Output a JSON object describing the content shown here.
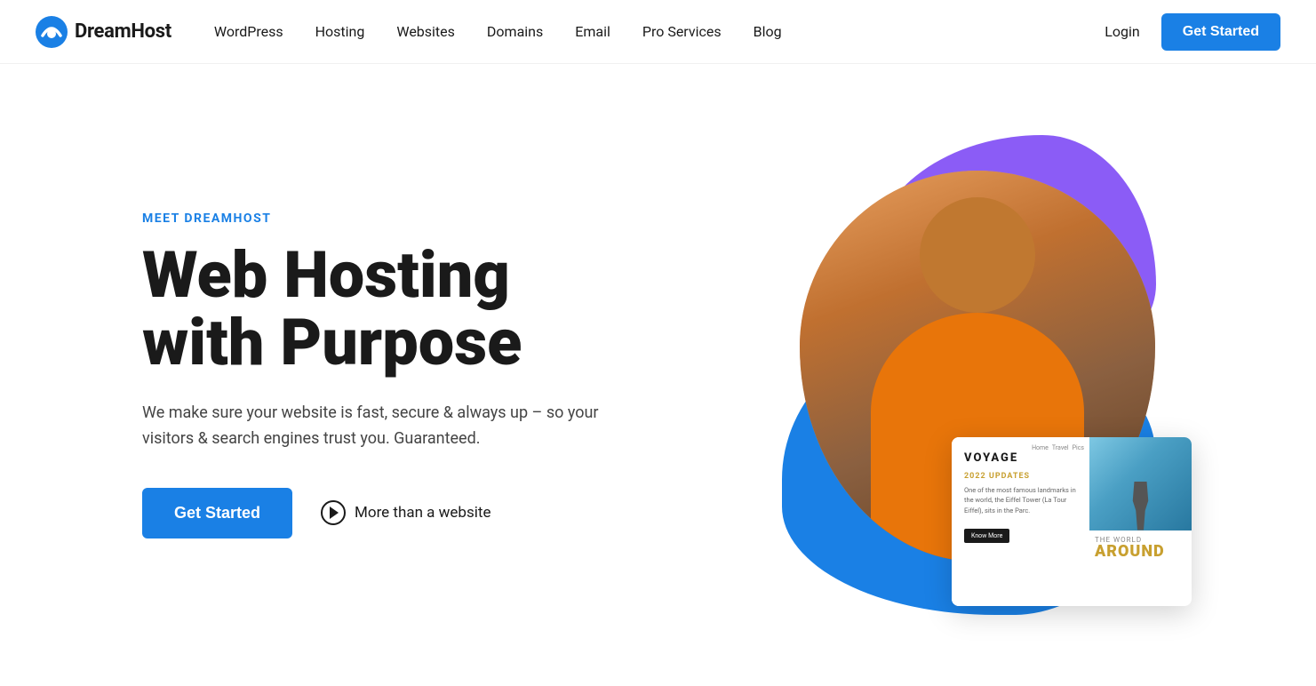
{
  "nav": {
    "logo_text": "DreamHost",
    "links": [
      {
        "label": "WordPress",
        "id": "wordpress"
      },
      {
        "label": "Hosting",
        "id": "hosting"
      },
      {
        "label": "Websites",
        "id": "websites"
      },
      {
        "label": "Domains",
        "id": "domains"
      },
      {
        "label": "Email",
        "id": "email"
      },
      {
        "label": "Pro Services",
        "id": "pro-services"
      },
      {
        "label": "Blog",
        "id": "blog"
      }
    ],
    "login_label": "Login",
    "get_started_label": "Get Started"
  },
  "hero": {
    "eyebrow": "MEET DREAMHOST",
    "title_line1": "Web Hosting",
    "title_line2": "with Purpose",
    "subtitle": "We make sure your website is fast, secure & always up – so your visitors & search engines trust you. Guaranteed.",
    "cta_label": "Get Started",
    "secondary_label": "More than a website"
  },
  "voyage_card": {
    "brand": "VOYAGE",
    "nav_items": [
      "Home",
      "Travel",
      "Pics"
    ],
    "updates_label": "2022 UPDATES",
    "description": "One of the most famous landmarks in the world, the Eiffel Tower (La Tour Eiffel), sits in the Parc.",
    "know_more": "Know More",
    "the": "THE WORLD",
    "around": "AROUND"
  },
  "colors": {
    "blue": "#1a80e5",
    "purple": "#8B5CF6",
    "accent_gold": "#c8a030"
  }
}
